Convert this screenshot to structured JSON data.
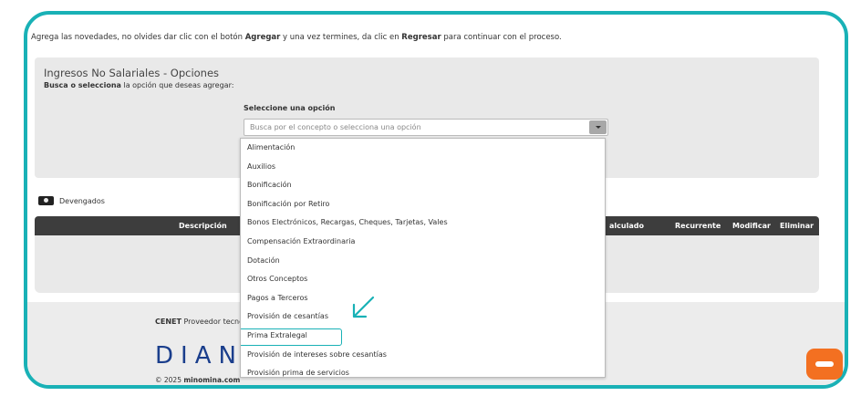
{
  "instruction": {
    "part1": "Agrega las novedades, no olvides dar clic con el botón ",
    "agregar": "Agregar",
    "part2": " y una vez termines, da clic en ",
    "regresar": "Regresar",
    "part3": " para continuar con el proceso."
  },
  "panel": {
    "title": "Ingresos No Salariales - Opciones",
    "subtitle_bold": "Busca o selecciona",
    "subtitle_rest": " la opción que deseas agregar:",
    "select_label": "Seleccione una opción",
    "select_placeholder": "Busca por el concepto o selecciona una opción"
  },
  "devengados": {
    "label": "Devengados"
  },
  "table": {
    "columns": [
      "Descripción",
      "alculado",
      "Recurrente",
      "Modificar",
      "Eliminar"
    ]
  },
  "dropdown": {
    "options": [
      "Alimentación",
      "Auxilios",
      "Bonificación",
      "Bonificación por Retiro",
      "Bonos Electrónicos, Recargas, Cheques, Tarjetas, Vales",
      "Compensación Extraordinaria",
      "Dotación",
      "Otros Conceptos",
      "Pagos a Terceros",
      "Provisión de cesantías",
      "Prima Extralegal",
      "Provisión de intereses sobre cesantías",
      "Provisión prima de servicios"
    ],
    "highlighted": "Prima Extralegal"
  },
  "footer": {
    "company": "CENET",
    "company_rest": " Proveedor tecno",
    "logo": "DIAN",
    "copyright": "© 2025 ",
    "site": "minomina.com"
  },
  "colors": {
    "accent": "#19b1b6",
    "header": "#3d3d3d",
    "chat": "#f37021"
  }
}
